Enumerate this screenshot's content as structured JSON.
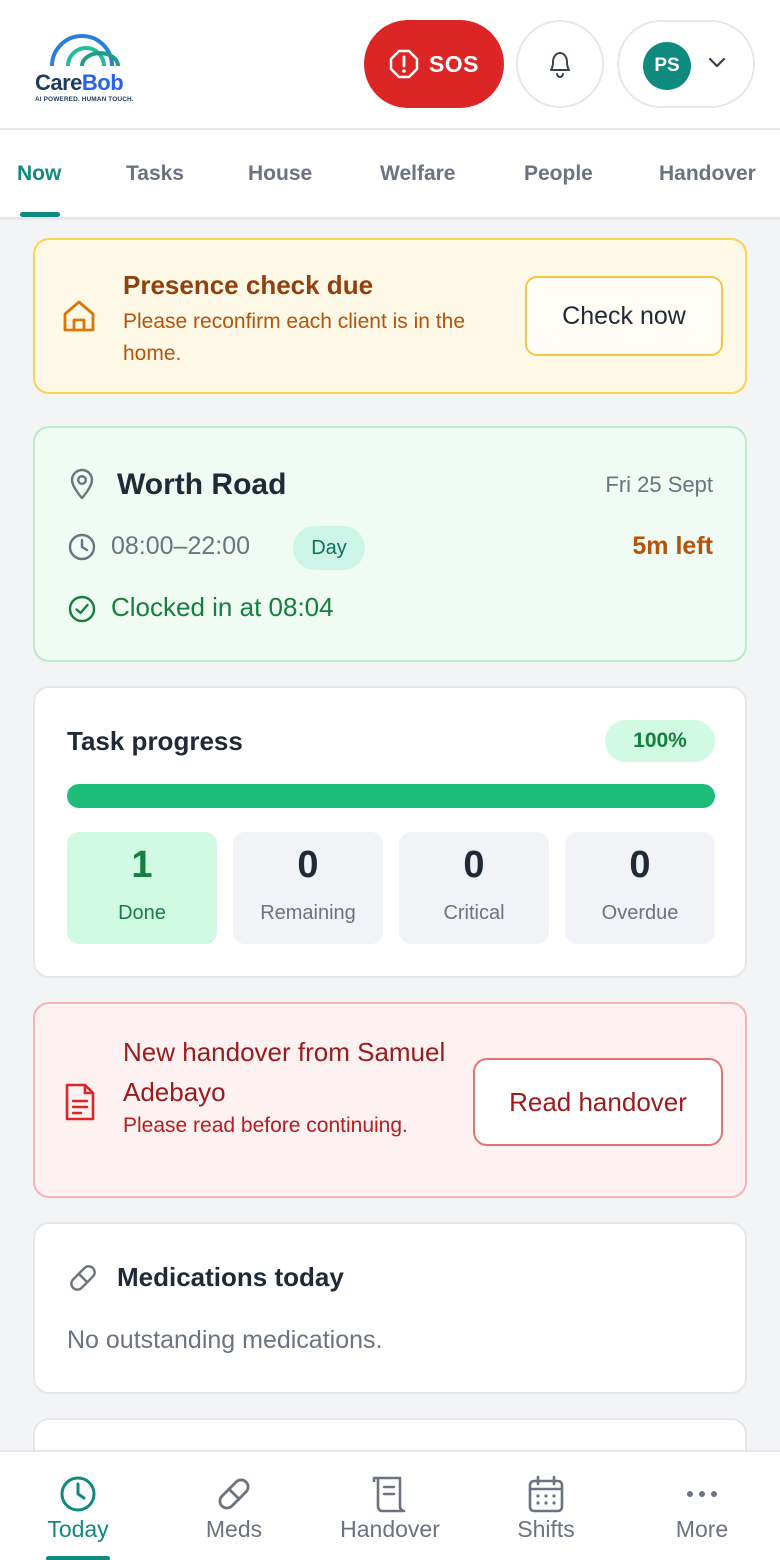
{
  "brand": {
    "name_part1": "Care",
    "name_part2": "Bob",
    "tagline": "AI POWERED. HUMAN TOUCH."
  },
  "header": {
    "sos_label": "SOS",
    "avatar_initials": "PS"
  },
  "tabs": [
    {
      "label": "Now",
      "active": true
    },
    {
      "label": "Tasks"
    },
    {
      "label": "House"
    },
    {
      "label": "Welfare"
    },
    {
      "label": "People"
    },
    {
      "label": "Handover"
    }
  ],
  "presence": {
    "title": "Presence check due",
    "subtitle": "Please reconfirm each client is in the home.",
    "button": "Check now"
  },
  "shift": {
    "location": "Worth Road",
    "date": "Fri 25 Sept",
    "time_range": "08:00–22:00",
    "badge": "Day",
    "time_left": "5m left",
    "clocked_in": "Clocked in at 08:04"
  },
  "progress": {
    "title": "Task progress",
    "percent_label": "100%",
    "fill_fraction": 1.0,
    "stats": [
      {
        "value": "1",
        "label": "Done"
      },
      {
        "value": "0",
        "label": "Remaining"
      },
      {
        "value": "0",
        "label": "Critical"
      },
      {
        "value": "0",
        "label": "Overdue"
      }
    ]
  },
  "handover": {
    "title": "New handover from Samuel Adebayo",
    "subtitle": "Please read before continuing.",
    "button": "Read handover"
  },
  "medications": {
    "title": "Medications today",
    "subtitle": "No outstanding medications."
  },
  "bottom_nav": [
    {
      "label": "Today",
      "icon": "clock-icon",
      "active": true
    },
    {
      "label": "Meds",
      "icon": "pill-icon"
    },
    {
      "label": "Handover",
      "icon": "scroll-icon"
    },
    {
      "label": "Shifts",
      "icon": "calendar-icon"
    },
    {
      "label": "More",
      "icon": "more-dots-icon"
    }
  ],
  "colors": {
    "brand_teal": "#0f8a7e",
    "sos_red": "#dc2626",
    "success_green": "#15803d",
    "warning_amber": "#b45309",
    "alert_red": "#991b1b"
  }
}
